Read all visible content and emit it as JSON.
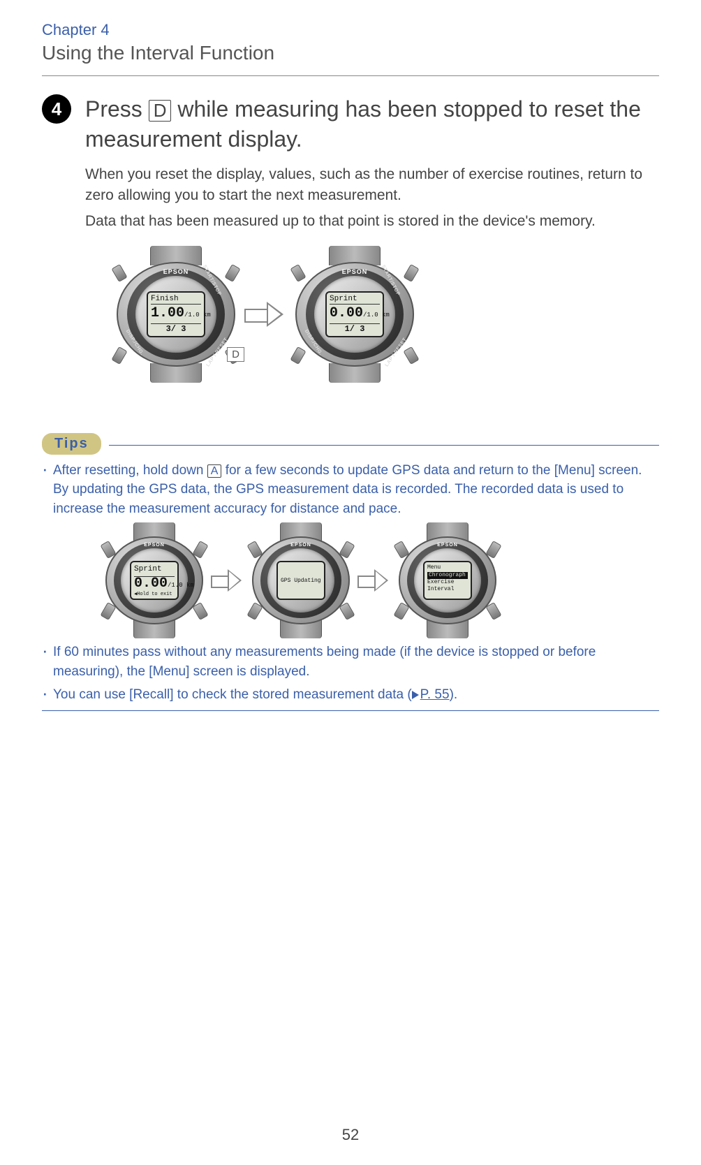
{
  "header": {
    "chapter": "Chapter 4",
    "section": "Using the Interval Function"
  },
  "step": {
    "num": "4",
    "title_before": "Press ",
    "title_key": "D",
    "title_after": " while measuring has been stopped to reset the measurement display.",
    "body1": "When you reset the display, values, such as the number of exercise routines, return to zero allowing you to start the next measurement.",
    "body2": "Data that has been measured up to that point is stored in the device's memory."
  },
  "watch_common": {
    "brand": "EPSON",
    "btn_tr": "START/STOP",
    "btn_br": "LAP / RESET",
    "btn_bl": "DISP./CHG."
  },
  "w1": {
    "top": "Finish",
    "mid_main": "1.00",
    "mid_unit": "/1.0 km",
    "bot": "3/ 3"
  },
  "keylabel": "D",
  "w2": {
    "top": "Sprint",
    "mid_main": "0.00",
    "mid_unit": "/1.0 km",
    "bot": "1/ 3"
  },
  "tips": {
    "label": "Tips",
    "t1_before": "After resetting, hold down ",
    "t1_key": "A",
    "t1_after": " for a few seconds to update GPS data and return to the [Menu] screen. By updating the GPS data, the GPS measurement data is recorded. The recorded data is used to increase the measurement accuracy for distance and pace.",
    "t2": "If 60 minutes pass without any measurements being made (if the device is stopped or before measuring), the [Menu] screen is displayed.",
    "t3_before": "You can use [Recall] to check the stored measurement data (",
    "t3_link": "P. 55",
    "t3_after": ")."
  },
  "w3": {
    "top": "Sprint",
    "mid_main": "0.00",
    "mid_unit": "/1.0 km",
    "bot": "◀Hold to exit"
  },
  "w4": {
    "mid": "GPS Updating"
  },
  "w5": {
    "l1": "Menu",
    "l2": "Chronograph",
    "l3": "Exercise",
    "l4": "Interval"
  },
  "page_number": "52"
}
